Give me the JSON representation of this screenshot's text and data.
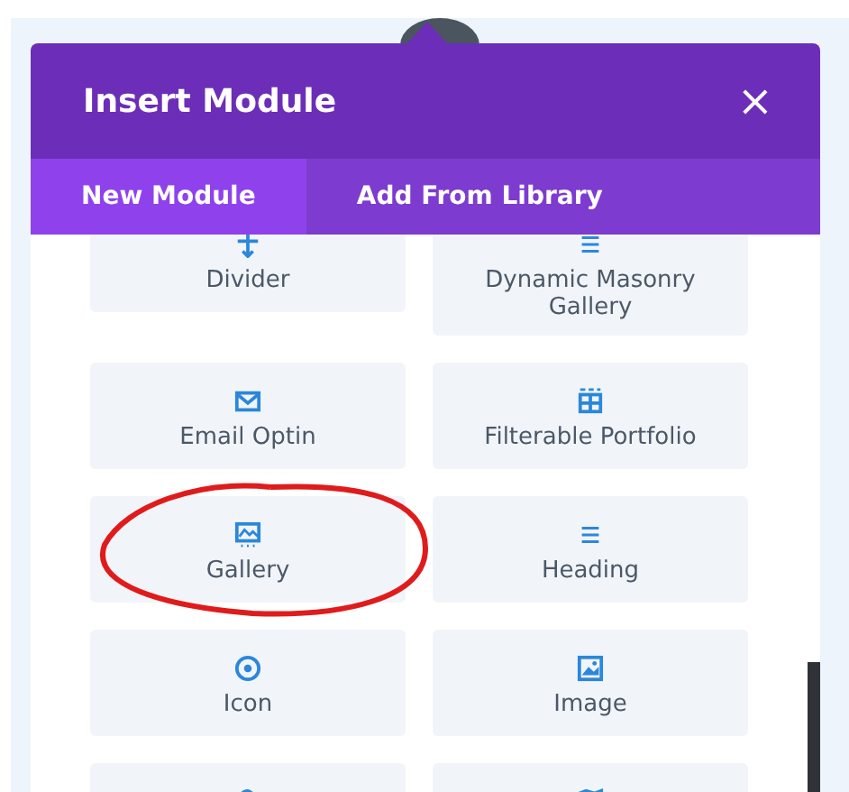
{
  "dialog": {
    "title": "Insert Module",
    "close": "×"
  },
  "tabs": [
    {
      "label": "New Module",
      "selected": true
    },
    {
      "label": "Add From Library",
      "selected": false
    }
  ],
  "modules": [
    {
      "kind": "divider",
      "label": "Divider"
    },
    {
      "kind": "lines",
      "label": "Dynamic Masonry Gallery"
    },
    {
      "kind": "mail",
      "label": "Email Optin"
    },
    {
      "kind": "grid",
      "label": "Filterable Portfolio"
    },
    {
      "kind": "gallery",
      "label": "Gallery"
    },
    {
      "kind": "lines",
      "label": "Heading"
    },
    {
      "kind": "target",
      "label": "Icon"
    },
    {
      "kind": "image",
      "label": "Image"
    },
    {
      "kind": "hook"
    },
    {
      "kind": "map"
    }
  ]
}
